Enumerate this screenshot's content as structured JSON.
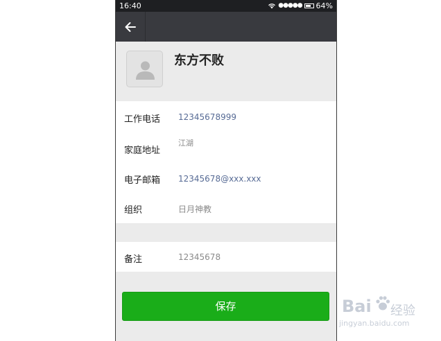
{
  "status_bar": {
    "time": "16:40",
    "signal": "●●●●●",
    "battery": "64%"
  },
  "navbar": {
    "back_icon": "arrow-left-icon"
  },
  "profile": {
    "name": "东方不败",
    "avatar_icon": "user-silhouette-icon"
  },
  "fields": {
    "work_phone": {
      "label": "工作电话",
      "value": "12345678999"
    },
    "home_address": {
      "label": "家庭地址",
      "value": "江湖"
    },
    "email": {
      "label": "电子邮箱",
      "value": "12345678@xxx.xxx"
    },
    "organization": {
      "label": "组织",
      "value": "日月神教"
    }
  },
  "remark": {
    "label": "备注",
    "value": "12345678"
  },
  "save_label": "保存",
  "watermark": {
    "brand": "Bai",
    "product": "经验",
    "url": "jingyan.baidu.com"
  },
  "colors": {
    "statusbar_bg": "#1e1f22",
    "navbar_bg": "#393a3f",
    "page_bg": "#ebebeb",
    "link": "#576b95",
    "primary_button": "#1aad19"
  }
}
